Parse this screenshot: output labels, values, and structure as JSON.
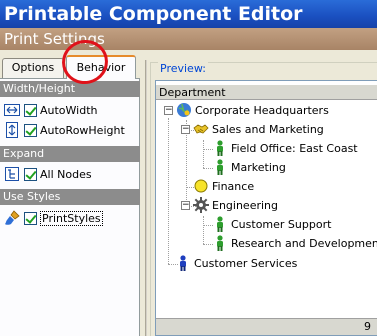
{
  "window": {
    "title": "Printable Component Editor",
    "subtitle": "Print Settings"
  },
  "tabs": [
    {
      "label": "Options"
    },
    {
      "label": "Behavior"
    }
  ],
  "groups": {
    "width_height": {
      "header": "Width/Height",
      "options": [
        {
          "label": "AutoWidth",
          "checked": true
        },
        {
          "label": "AutoRowHeight",
          "checked": true
        }
      ]
    },
    "expand": {
      "header": "Expand",
      "options": [
        {
          "label": "All Nodes",
          "checked": true
        }
      ]
    },
    "use_styles": {
      "header": "Use Styles",
      "options": [
        {
          "label": "PrintStyles",
          "checked": true
        }
      ]
    }
  },
  "preview": {
    "label": "Preview:",
    "column_header": "Department",
    "nodes": [
      {
        "label": "Corporate Headquarters",
        "icon": "globe-person-icon",
        "expander": "−"
      },
      {
        "label": "Sales and Marketing",
        "icon": "handshake-icon",
        "expander": "−"
      },
      {
        "label": "Field Office: East Coast",
        "icon": "green-person-icon"
      },
      {
        "label": "Marketing",
        "icon": "green-person-icon"
      },
      {
        "label": "Finance",
        "icon": "yellow-circle-icon"
      },
      {
        "label": "Engineering",
        "icon": "gear-icon",
        "expander": "−"
      },
      {
        "label": "Customer Support",
        "icon": "green-person-icon"
      },
      {
        "label": "Research and Development",
        "icon": "green-person-icon"
      },
      {
        "label": "Customer Services",
        "icon": "blue-person-icon"
      }
    ],
    "footer_value": "9"
  }
}
